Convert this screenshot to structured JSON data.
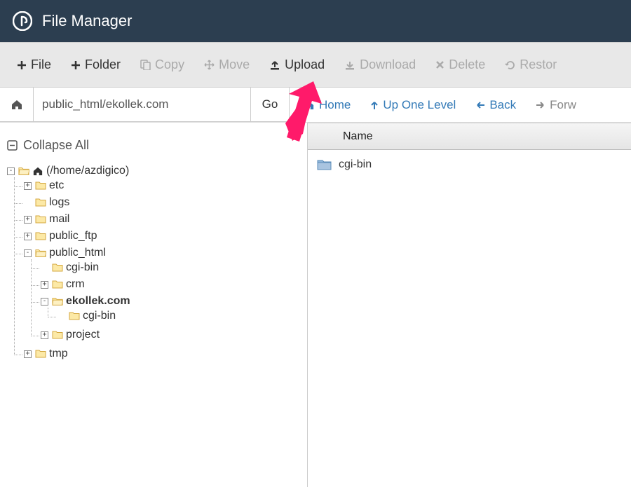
{
  "header": {
    "title": "File Manager"
  },
  "toolbar": {
    "file": "File",
    "folder": "Folder",
    "copy": "Copy",
    "move": "Move",
    "upload": "Upload",
    "download": "Download",
    "delete": "Delete",
    "restore": "Restor"
  },
  "path": {
    "value": "public_html/ekollek.com",
    "go": "Go"
  },
  "nav": {
    "home": "Home",
    "up": "Up One Level",
    "back": "Back",
    "forward": "Forw"
  },
  "sidebar": {
    "collapse": "Collapse All"
  },
  "tree": {
    "root": "(/home/azdigico)",
    "etc": "etc",
    "logs": "logs",
    "mail": "mail",
    "public_ftp": "public_ftp",
    "public_html": "public_html",
    "cgi_bin": "cgi-bin",
    "crm": "crm",
    "ekollek": "ekollek.com",
    "ekollek_cgi": "cgi-bin",
    "project": "project",
    "tmp": "tmp"
  },
  "content": {
    "column_name": "Name",
    "rows": [
      {
        "name": "cgi-bin"
      }
    ]
  }
}
